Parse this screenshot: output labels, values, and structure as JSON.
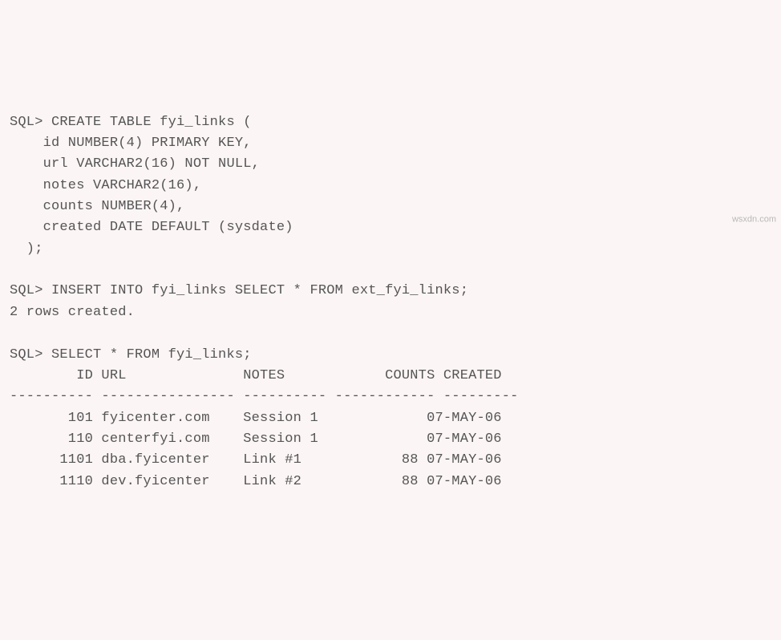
{
  "terminal": {
    "prompt": "SQL>",
    "create_stmt": {
      "line1": "SQL> CREATE TABLE fyi_links (",
      "line2": "    id NUMBER(4) PRIMARY KEY,",
      "line3": "    url VARCHAR2(16) NOT NULL,",
      "line4": "    notes VARCHAR2(16),",
      "line5": "    counts NUMBER(4),",
      "line6": "    created DATE DEFAULT (sysdate)",
      "line7": "  );"
    },
    "insert_stmt": "SQL> INSERT INTO fyi_links SELECT * FROM ext_fyi_links;",
    "insert_result": "2 rows created.",
    "select_stmt": "SQL> SELECT * FROM fyi_links;",
    "headers": {
      "id": "ID",
      "url": "URL",
      "notes": "NOTES",
      "counts": "COUNTS",
      "created": "CREATED"
    },
    "header_line": "        ID URL              NOTES            COUNTS CREATED",
    "separator_line": "---------- ---------------- ---------- ------------ ---------",
    "rows": [
      {
        "id": "101",
        "url": "fyicenter.com",
        "notes": "Session 1",
        "counts": "",
        "created": "07-MAY-06"
      },
      {
        "id": "110",
        "url": "centerfyi.com",
        "notes": "Session 1",
        "counts": "",
        "created": "07-MAY-06"
      },
      {
        "id": "1101",
        "url": "dba.fyicenter",
        "notes": "Link #1",
        "counts": "88",
        "created": "07-MAY-06"
      },
      {
        "id": "1110",
        "url": "dev.fyicenter",
        "notes": "Link #2",
        "counts": "88",
        "created": "07-MAY-06"
      }
    ],
    "row_lines": [
      "       101 fyicenter.com    Session 1             07-MAY-06",
      "       110 centerfyi.com    Session 1             07-MAY-06",
      "      1101 dba.fyicenter    Link #1            88 07-MAY-06",
      "      1110 dev.fyicenter    Link #2            88 07-MAY-06"
    ]
  },
  "watermark": "wsxdn.com"
}
